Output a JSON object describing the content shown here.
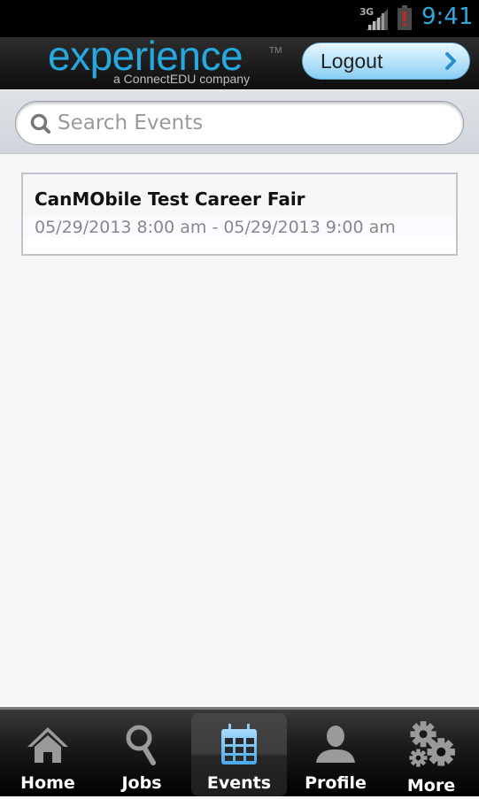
{
  "status_bar": {
    "network_type": "3G",
    "time": "9:41",
    "icons": [
      "signal-icon",
      "battery-alert-icon"
    ]
  },
  "header": {
    "logo_text": "experience",
    "logo_trademark": "TM",
    "logo_subtitle": "a ConnectEDU company",
    "logout_label": "Logout"
  },
  "search": {
    "placeholder": "Search Events",
    "value": ""
  },
  "events": [
    {
      "title": "CanMObile Test Career Fair",
      "dates": "05/29/2013 8:00 am - 05/29/2013 9:00 am"
    }
  ],
  "tabbar": {
    "active": "Events",
    "tabs": [
      {
        "label": "Home",
        "icon": "home-icon"
      },
      {
        "label": "Jobs",
        "icon": "search-icon"
      },
      {
        "label": "Events",
        "icon": "calendar-icon"
      },
      {
        "label": "Profile",
        "icon": "person-icon"
      },
      {
        "label": "More",
        "icon": "gears-icon"
      }
    ]
  },
  "colors": {
    "accent_blue": "#26a9e0",
    "clock_blue": "#2fa8e0",
    "battery_alert": "#e02020",
    "calendar_blue": "#6cbff0"
  }
}
